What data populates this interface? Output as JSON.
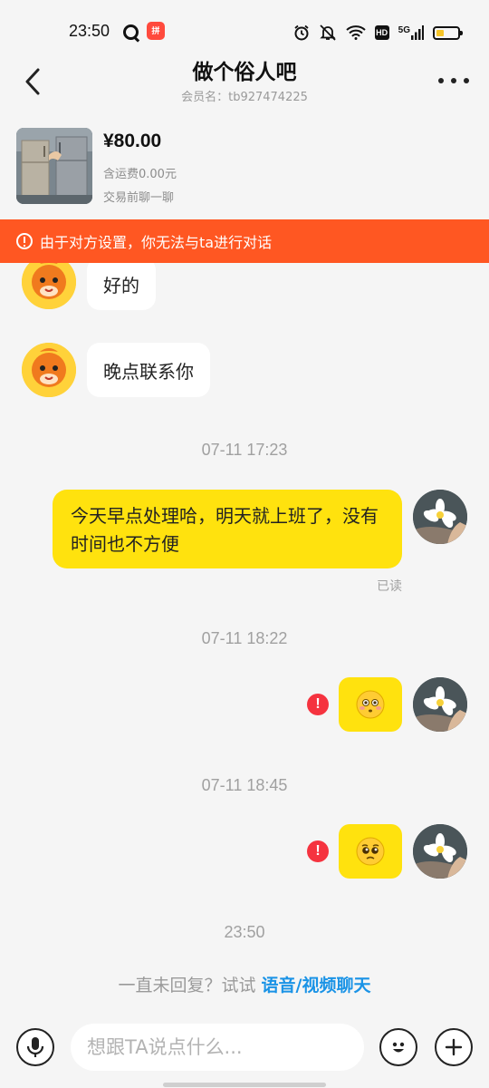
{
  "status_bar": {
    "time": "23:50",
    "app_badge": "拼",
    "hd": "HD",
    "network": "5G",
    "icons": [
      "alarm-icon",
      "mute-icon",
      "wifi-icon",
      "hd-icon",
      "signal-icon",
      "battery-icon"
    ]
  },
  "header": {
    "title": "做个俗人吧",
    "subtitle": "会员名：tb927474225"
  },
  "product": {
    "price": "¥80.00",
    "shipping": "含运费0.00元",
    "note": "交易前聊一聊"
  },
  "banner": {
    "text": "由于对方设置，你无法与ta进行对话"
  },
  "messages": {
    "in_1": "好的",
    "in_2": "晚点联系你",
    "time_1": "07-11 17:23",
    "out_1": "今天早点处理哈，明天就上班了，没有时间也不方便",
    "read_label": "已读",
    "time_2": "07-11 18:22",
    "time_3": "07-11 18:45",
    "time_4": "23:50",
    "fail_mark": "!"
  },
  "hint": {
    "prefix": "一直未回复？试试 ",
    "link": "语音/视频聊天"
  },
  "input": {
    "placeholder": "想跟TA说点什么..."
  },
  "colors": {
    "banner": "#ff5722",
    "bubble_out": "#ffe20e",
    "link": "#1a93e6",
    "fail": "#f5333f"
  }
}
